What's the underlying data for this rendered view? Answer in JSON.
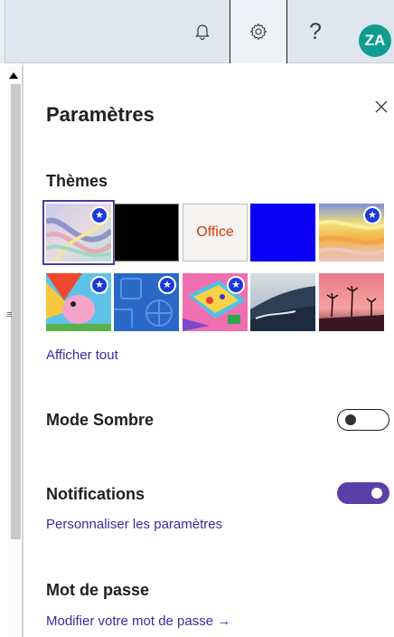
{
  "topbar": {
    "help_label": "?",
    "avatar_initials": "ZA",
    "avatar_color": "#0f9d8f"
  },
  "panel": {
    "title": "Paramètres",
    "close_icon": "close-icon"
  },
  "themes": {
    "heading": "Thèmes",
    "office_label": "Office",
    "show_all": "Afficher tout",
    "selected_index": 0
  },
  "dark_mode": {
    "label": "Mode Sombre",
    "enabled": false
  },
  "notifications": {
    "label": "Notifications",
    "enabled": true,
    "link": "Personnaliser les paramètres",
    "toggle_color": "#5b3fa8"
  },
  "password": {
    "label": "Mot de passe",
    "link": "Modifier votre mot de passe →"
  },
  "colors": {
    "link": "#3a2aa0",
    "accent": "#4b3c9c",
    "star_badge": "#1b3bd6"
  }
}
